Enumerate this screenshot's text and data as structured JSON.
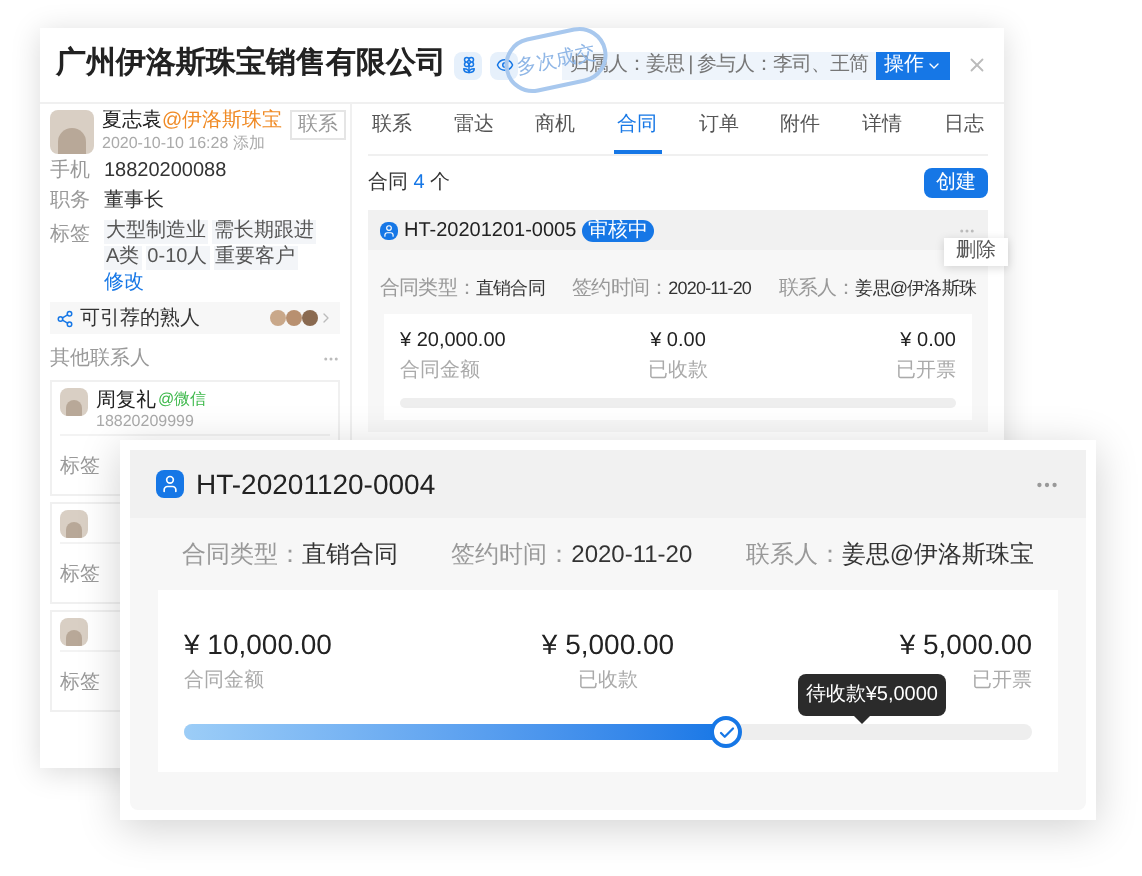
{
  "back_window": {
    "title": "广州伊洛斯珠宝销售有限公司",
    "stamp": "多次成交",
    "owner_info": "归属人：姜思 | 参与人：李司、王简",
    "action_button": "操作",
    "contact": {
      "name": "夏志袁",
      "company": "@伊洛斯珠宝",
      "time": "2020-10-10 16:28 添加",
      "button": "联系",
      "fields": [
        {
          "label": "手机",
          "value": "18820200088"
        },
        {
          "label": "职务",
          "value": "董事长"
        }
      ],
      "tags_label": "标签",
      "tags": [
        "大型制造业",
        "需长期跟进",
        "A类",
        "0-10人",
        "重要客户"
      ],
      "edit_link": "修改"
    },
    "referral": {
      "label": "可引荐的熟人"
    },
    "others": {
      "title": "其他联系人",
      "items": [
        {
          "name": "周复礼",
          "source": "@微信",
          "phone": "18820209999",
          "tags_label": "标签"
        },
        {
          "tags_label": "标签"
        },
        {
          "tags_label": "标签"
        }
      ]
    },
    "tabs": [
      {
        "label": "联系",
        "selected": false
      },
      {
        "label": "雷达",
        "selected": false
      },
      {
        "label": "商机",
        "selected": false
      },
      {
        "label": "合同",
        "selected": true
      },
      {
        "label": "订单",
        "selected": false
      },
      {
        "label": "附件",
        "selected": false
      },
      {
        "label": "详情",
        "selected": false
      },
      {
        "label": "日志",
        "selected": false
      }
    ],
    "contracts": {
      "title": "合同",
      "count": "4",
      "unit": "个",
      "create_button": "创建",
      "card": {
        "code": "HT-20201201-0005",
        "status": "审核中",
        "menu_item": "删除",
        "meta": [
          {
            "label": "合同类型：",
            "value": "直销合同"
          },
          {
            "label": "签约时间：",
            "value": "2020-11-20"
          },
          {
            "label": "联系人：",
            "value": "姜思@伊洛斯珠"
          }
        ],
        "amounts": [
          {
            "value": "¥ 20,000.00",
            "label": "合同金额"
          },
          {
            "value": "¥ 0.00",
            "label": "已收款"
          },
          {
            "value": "¥ 0.00",
            "label": "已开票"
          }
        ],
        "level": 0
      }
    }
  },
  "front_card": {
    "code": "HT-20201120-0004",
    "meta": [
      {
        "label": "合同类型：",
        "value": "直销合同"
      },
      {
        "label": "签约时间：",
        "value": "2020-11-20"
      },
      {
        "label": "联系人：",
        "value": "姜思@伊洛斯珠宝"
      }
    ],
    "amounts": [
      {
        "value": "¥ 10,000.00",
        "label": "合同金额"
      },
      {
        "value": "¥ 5,000.00",
        "label": "已收款"
      },
      {
        "value": "¥ 5,000.00",
        "label": "已开票"
      }
    ],
    "level": 0.64,
    "tooltip": "待收款¥5,0000"
  }
}
